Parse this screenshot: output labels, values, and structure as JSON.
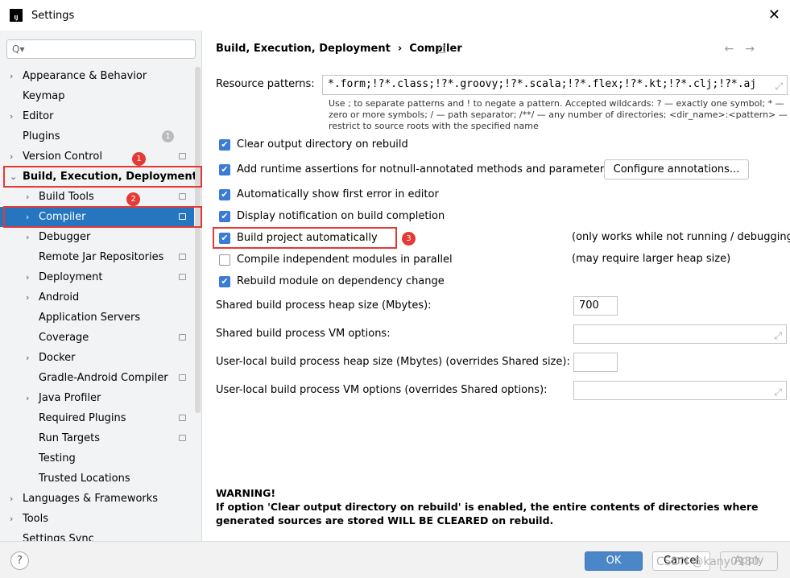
{
  "window": {
    "title": "Settings",
    "logo": "IJ",
    "close_icon": "close-icon"
  },
  "sidebar": {
    "search_placeholder": "Q▾",
    "items": [
      {
        "label": "Appearance & Behavior",
        "arrow": "›",
        "level": 0
      },
      {
        "label": "Keymap",
        "arrow": "",
        "level": 0
      },
      {
        "label": "Editor",
        "arrow": "›",
        "level": 0
      },
      {
        "label": "Plugins",
        "arrow": "",
        "level": 0,
        "badge": "1"
      },
      {
        "label": "Version Control",
        "arrow": "›",
        "level": 0,
        "mod": true
      },
      {
        "label": "Build, Execution, Deployment",
        "arrow": "⌄",
        "level": 0,
        "bold": true
      },
      {
        "label": "Build Tools",
        "arrow": "›",
        "level": 1,
        "mod": true
      },
      {
        "label": "Compiler",
        "arrow": "›",
        "level": 1,
        "mod": true,
        "selected": true
      },
      {
        "label": "Debugger",
        "arrow": "›",
        "level": 1
      },
      {
        "label": "Remote Jar Repositories",
        "arrow": "",
        "level": 1,
        "mod": true
      },
      {
        "label": "Deployment",
        "arrow": "›",
        "level": 1,
        "mod": true
      },
      {
        "label": "Android",
        "arrow": "›",
        "level": 1
      },
      {
        "label": "Application Servers",
        "arrow": "",
        "level": 1
      },
      {
        "label": "Coverage",
        "arrow": "",
        "level": 1,
        "mod": true
      },
      {
        "label": "Docker",
        "arrow": "›",
        "level": 1
      },
      {
        "label": "Gradle-Android Compiler",
        "arrow": "",
        "level": 1,
        "mod": true
      },
      {
        "label": "Java Profiler",
        "arrow": "›",
        "level": 1
      },
      {
        "label": "Required Plugins",
        "arrow": "",
        "level": 1,
        "mod": true
      },
      {
        "label": "Run Targets",
        "arrow": "",
        "level": 1,
        "mod": true
      },
      {
        "label": "Testing",
        "arrow": "",
        "level": 1
      },
      {
        "label": "Trusted Locations",
        "arrow": "",
        "level": 1
      },
      {
        "label": "Languages & Frameworks",
        "arrow": "›",
        "level": 0
      },
      {
        "label": "Tools",
        "arrow": "›",
        "level": 0
      },
      {
        "label": "Settings Sync",
        "arrow": "",
        "level": 0
      }
    ]
  },
  "annotations": [
    "1",
    "2",
    "3"
  ],
  "main": {
    "breadcrumb": "Build, Execution, Deployment  ›  Compiler",
    "nav": "←→",
    "resource_label": "Resource patterns:",
    "resource_value": "*.form;!?*.class;!?*.groovy;!?*.scala;!?*.flex;!?*.kt;!?*.clj;!?*.aj",
    "hint": "Use ; to separate patterns and ! to negate a pattern. Accepted wildcards: ? — exactly one symbol; * — zero or more symbols; / — path separator; /**/ — any number of directories; <dir_name>:<pattern> — restrict to source roots with the specified name",
    "checkboxes": [
      {
        "label": "Clear output directory on rebuild",
        "checked": true
      },
      {
        "label": "Add runtime assertions for notnull-annotated methods and parameters",
        "checked": true
      },
      {
        "label": "Automatically show first error in editor",
        "checked": true
      },
      {
        "label": "Display notification on build completion",
        "checked": true
      },
      {
        "label": "Build project automatically",
        "checked": true
      },
      {
        "label": "Compile independent modules in parallel",
        "checked": false
      },
      {
        "label": "Rebuild module on dependency change",
        "checked": true
      }
    ],
    "configure_button": "Configure annotations...",
    "note_auto": "(only works while not running / debugging)",
    "note_parallel": "(may require larger heap size)",
    "heap_label": "Shared build process heap size (Mbytes):",
    "heap_value": "700",
    "vm_label": "Shared build process VM options:",
    "vm_value": "",
    "local_heap_label": "User-local build process heap size (Mbytes) (overrides Shared size):",
    "local_heap_value": "",
    "local_vm_label": "User-local build process VM options (overrides Shared options):",
    "local_vm_value": "",
    "warning_title": "WARNING!",
    "warning_text": "If option 'Clear output directory on rebuild' is enabled, the entire contents of directories where generated sources are stored WILL BE CLEARED on rebuild."
  },
  "footer": {
    "help": "?",
    "ok": "OK",
    "cancel": "Cancel",
    "apply": "Apply",
    "accent": "#4a86c8"
  },
  "watermark": "CSDN @kany0130"
}
